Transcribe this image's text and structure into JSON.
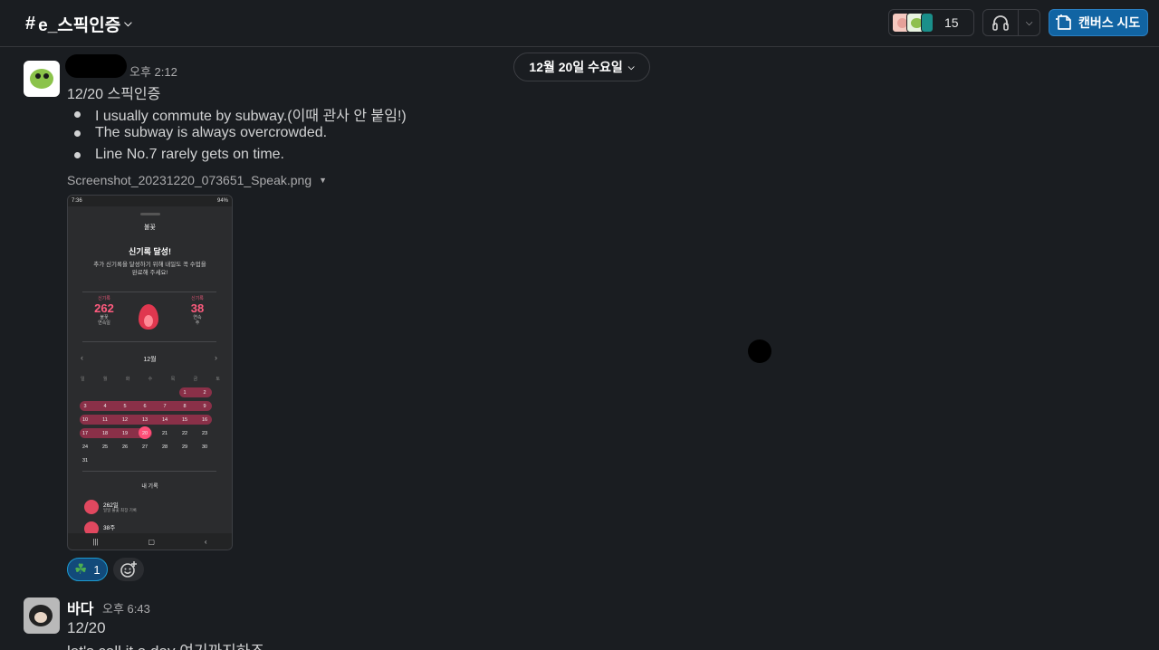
{
  "header": {
    "channel_name": "e_스픽인증",
    "member_count": "15",
    "canvas_label": "캔버스 시도"
  },
  "date_divider": "12월 20일 수요일",
  "messages": [
    {
      "time": "오후 2:12",
      "text": "12/20 스픽인증",
      "bullets": [
        "I usually commute by subway.(이때 관사 안 붙임!)",
        "The subway is always overcrowded.",
        "Line No.7 rarely gets on time."
      ],
      "attachment": {
        "filename": "Screenshot_20231220_073651_Speak.png",
        "preview": {
          "status_time": "7:36",
          "status_right": "94%",
          "screen_title": "불꽃",
          "headline": "신기록 달성!",
          "body_line1": "추가 신기록을 달성하기 위해 내일도 꼭 수업을",
          "body_line2": "완료해 주세요!",
          "stat_left": {
            "label": "신기록",
            "value": "262",
            "sub1": "불꽃",
            "sub2": "연속일"
          },
          "stat_right": {
            "label": "신기록",
            "value": "38",
            "sub1": "연속",
            "sub2": "주"
          },
          "month": "12월",
          "weekdays": [
            "일",
            "월",
            "화",
            "수",
            "목",
            "금",
            "토"
          ],
          "records_title": "내 기록",
          "record1": {
            "value": "262일",
            "sub": "일일 불꽃 최장 기록"
          },
          "record2": {
            "value": "38주"
          }
        }
      },
      "reaction": {
        "emoji": "☘",
        "count": "1"
      }
    },
    {
      "sender": "바다",
      "time": "오후 6:43",
      "line1": "12/20",
      "line2": "let's call it a day 여기까지하죠"
    }
  ],
  "colors": {
    "background": "#1a1d21",
    "accent": "#1164a3",
    "reaction_bg": "#124a7a",
    "streak": "#ff5b7e"
  }
}
